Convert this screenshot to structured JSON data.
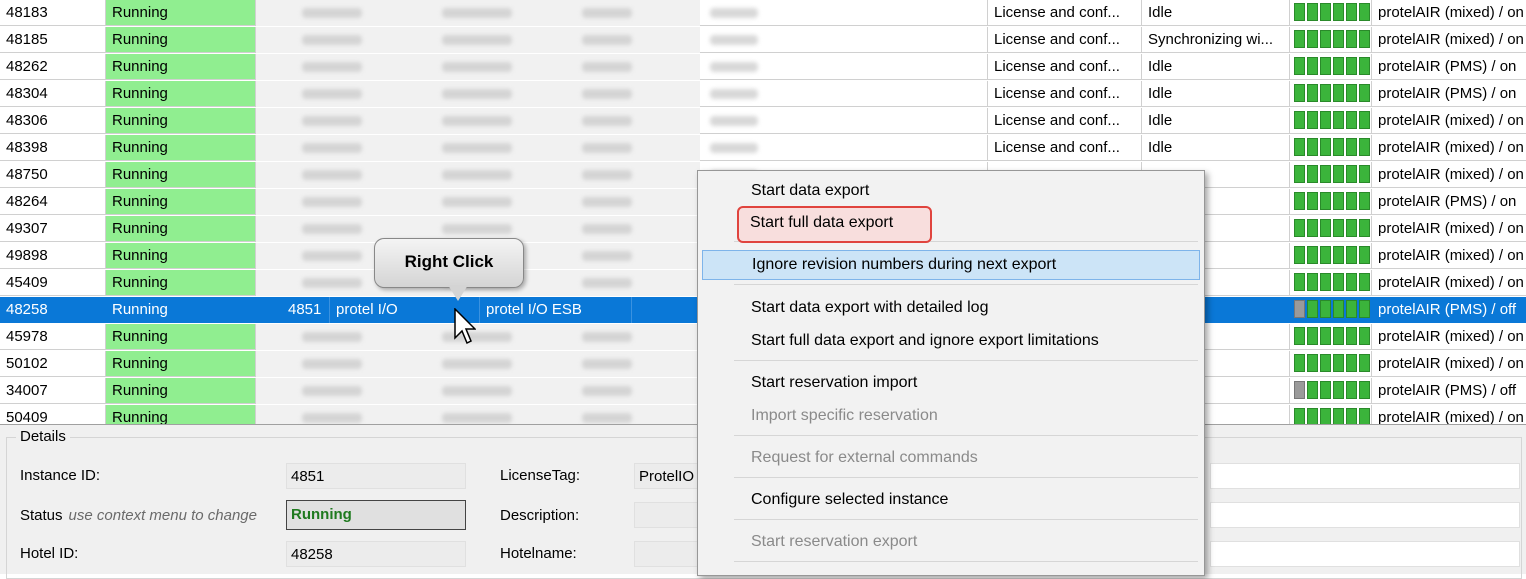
{
  "grid": {
    "rows": [
      {
        "id": "48183",
        "status": "Running",
        "license": "License and conf...",
        "state": "Idle",
        "meter_gray": false,
        "product": "protelAIR (mixed) / on"
      },
      {
        "id": "48185",
        "status": "Running",
        "license": "License and conf...",
        "state": "Synchronizing wi...",
        "meter_gray": false,
        "product": "protelAIR (mixed) / on"
      },
      {
        "id": "48262",
        "status": "Running",
        "license": "License and conf...",
        "state": "Idle",
        "meter_gray": false,
        "product": "protelAIR (PMS) / on"
      },
      {
        "id": "48304",
        "status": "Running",
        "license": "License and conf...",
        "state": "Idle",
        "meter_gray": false,
        "product": "protelAIR (PMS) / on"
      },
      {
        "id": "48306",
        "status": "Running",
        "license": "License and conf...",
        "state": "Idle",
        "meter_gray": false,
        "product": "protelAIR (mixed) / on"
      },
      {
        "id": "48398",
        "status": "Running",
        "license": "License and conf...",
        "state": "Idle",
        "meter_gray": false,
        "product": "protelAIR (mixed) / on"
      },
      {
        "id": "48750",
        "status": "Running",
        "license": "",
        "state": "",
        "meter_gray": false,
        "product": "protelAIR (mixed) / on"
      },
      {
        "id": "48264",
        "status": "Running",
        "license": "",
        "state": "",
        "meter_gray": false,
        "product": "protelAIR (PMS) / on"
      },
      {
        "id": "49307",
        "status": "Running",
        "license": "",
        "state": "",
        "meter_gray": false,
        "product": "protelAIR (mixed) / on"
      },
      {
        "id": "49898",
        "status": "Running",
        "license": "",
        "state": "",
        "meter_gray": false,
        "product": "protelAIR (mixed) / on"
      },
      {
        "id": "45409",
        "status": "Running",
        "license": "",
        "state": "",
        "meter_gray": false,
        "product": "protelAIR (mixed) / on"
      },
      {
        "id": "48258",
        "status": "Running",
        "license": "",
        "state": "",
        "meter_gray": true,
        "product": "protelAIR (PMS) / off",
        "selected": true,
        "num": "4851",
        "iface": "protel I/O",
        "iface2": "protel I/O ESB"
      },
      {
        "id": "45978",
        "status": "Running",
        "license": "",
        "state": "",
        "meter_gray": false,
        "product": "protelAIR (mixed) / on"
      },
      {
        "id": "50102",
        "status": "Running",
        "license": "",
        "state": "",
        "meter_gray": false,
        "product": "protelAIR (mixed) / on"
      },
      {
        "id": "34007",
        "status": "Running",
        "license": "",
        "state": "",
        "meter_gray": true,
        "product": "protelAIR (PMS) / off"
      },
      {
        "id": "50409",
        "status": "Running",
        "license": "",
        "state": "",
        "meter_gray": false,
        "product": "protelAIR (mixed) / on"
      }
    ]
  },
  "callout": {
    "label": "Right Click"
  },
  "context_menu": {
    "items": [
      {
        "label": "Start data export",
        "disabled": false
      },
      {
        "label": "Start full data export",
        "disabled": false,
        "highlighted": true
      },
      {
        "label": "Ignore revision numbers during next export",
        "disabled": false,
        "hover": true
      },
      {
        "label": "Start data export with detailed log",
        "disabled": false
      },
      {
        "label": "Start full data export and ignore export limitations",
        "disabled": false
      },
      {
        "label": "Start reservation import",
        "disabled": false
      },
      {
        "label": "Import specific reservation",
        "disabled": true
      },
      {
        "label": "Request for external commands",
        "disabled": true
      },
      {
        "label": "Configure selected instance",
        "disabled": false
      },
      {
        "label": "Start reservation export",
        "disabled": true
      }
    ]
  },
  "details": {
    "legend": "Details",
    "instance_id_label": "Instance ID:",
    "instance_id": "4851",
    "status_label": "Status",
    "status_hint": "use context menu to change",
    "status_value": "Running",
    "hotel_id_label": "Hotel ID:",
    "hotel_id": "48258",
    "license_tag_label": "LicenseTag:",
    "license_tag": "ProtelIO",
    "description_label": "Description:",
    "hotelname_label": "Hotelname:"
  }
}
